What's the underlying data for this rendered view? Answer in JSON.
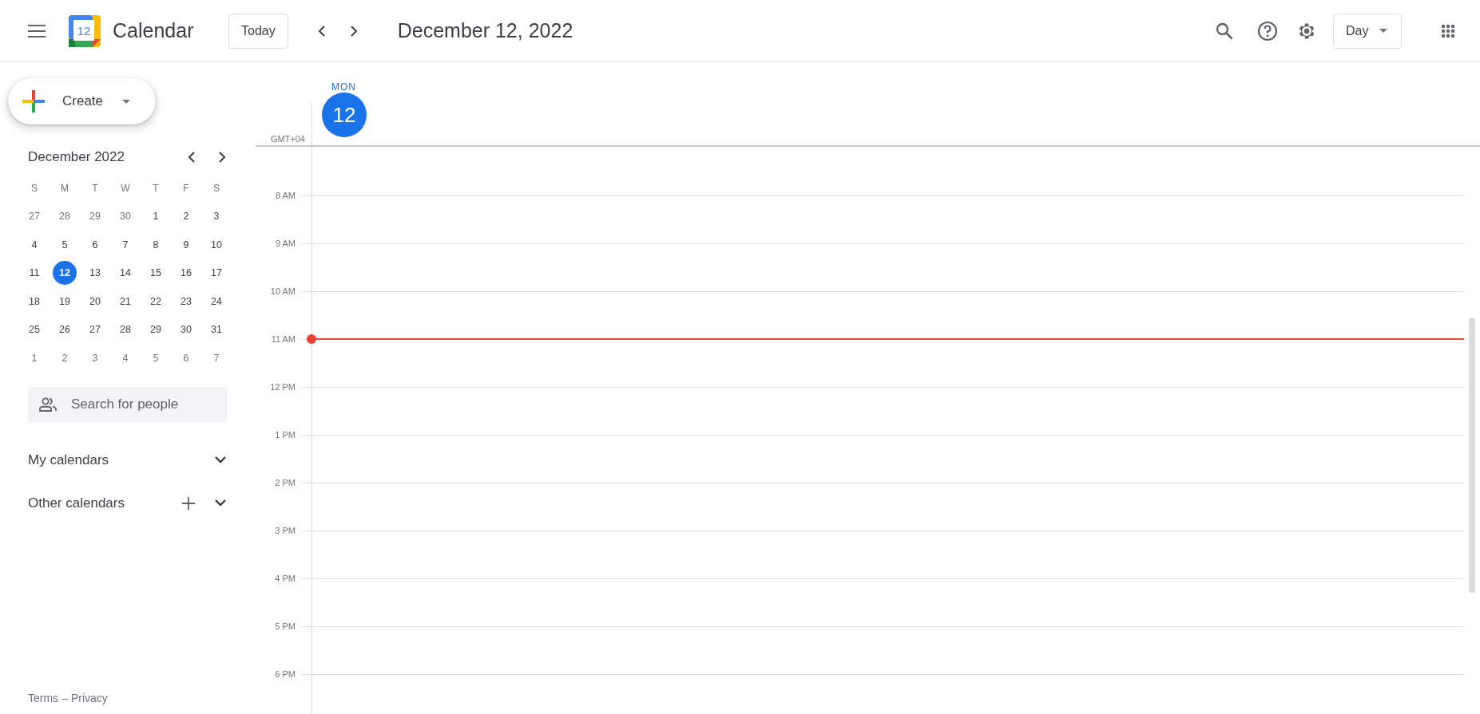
{
  "header": {
    "app_name": "Calendar",
    "logo_day": "12",
    "today_button": "Today",
    "date_title": "December 12, 2022",
    "view_select": "Day"
  },
  "sidebar": {
    "create_button": "Create",
    "mini_calendar": {
      "title": "December 2022",
      "weekdays": [
        "S",
        "M",
        "T",
        "W",
        "T",
        "F",
        "S"
      ],
      "weeks": [
        [
          {
            "day": "27",
            "muted": true,
            "selected": false
          },
          {
            "day": "28",
            "muted": true,
            "selected": false
          },
          {
            "day": "29",
            "muted": true,
            "selected": false
          },
          {
            "day": "30",
            "muted": true,
            "selected": false
          },
          {
            "day": "1",
            "muted": false,
            "selected": false
          },
          {
            "day": "2",
            "muted": false,
            "selected": false
          },
          {
            "day": "3",
            "muted": false,
            "selected": false
          }
        ],
        [
          {
            "day": "4",
            "muted": false,
            "selected": false
          },
          {
            "day": "5",
            "muted": false,
            "selected": false
          },
          {
            "day": "6",
            "muted": false,
            "selected": false
          },
          {
            "day": "7",
            "muted": false,
            "selected": false
          },
          {
            "day": "8",
            "muted": false,
            "selected": false
          },
          {
            "day": "9",
            "muted": false,
            "selected": false
          },
          {
            "day": "10",
            "muted": false,
            "selected": false
          }
        ],
        [
          {
            "day": "11",
            "muted": false,
            "selected": false
          },
          {
            "day": "12",
            "muted": false,
            "selected": true
          },
          {
            "day": "13",
            "muted": false,
            "selected": false
          },
          {
            "day": "14",
            "muted": false,
            "selected": false
          },
          {
            "day": "15",
            "muted": false,
            "selected": false
          },
          {
            "day": "16",
            "muted": false,
            "selected": false
          },
          {
            "day": "17",
            "muted": false,
            "selected": false
          }
        ],
        [
          {
            "day": "18",
            "muted": false,
            "selected": false
          },
          {
            "day": "19",
            "muted": false,
            "selected": false
          },
          {
            "day": "20",
            "muted": false,
            "selected": false
          },
          {
            "day": "21",
            "muted": false,
            "selected": false
          },
          {
            "day": "22",
            "muted": false,
            "selected": false
          },
          {
            "day": "23",
            "muted": false,
            "selected": false
          },
          {
            "day": "24",
            "muted": false,
            "selected": false
          }
        ],
        [
          {
            "day": "25",
            "muted": false,
            "selected": false
          },
          {
            "day": "26",
            "muted": false,
            "selected": false
          },
          {
            "day": "27",
            "muted": false,
            "selected": false
          },
          {
            "day": "28",
            "muted": false,
            "selected": false
          },
          {
            "day": "29",
            "muted": false,
            "selected": false
          },
          {
            "day": "30",
            "muted": false,
            "selected": false
          },
          {
            "day": "31",
            "muted": false,
            "selected": false
          }
        ],
        [
          {
            "day": "1",
            "muted": true,
            "selected": false
          },
          {
            "day": "2",
            "muted": true,
            "selected": false
          },
          {
            "day": "3",
            "muted": true,
            "selected": false
          },
          {
            "day": "4",
            "muted": true,
            "selected": false
          },
          {
            "day": "5",
            "muted": true,
            "selected": false
          },
          {
            "day": "6",
            "muted": true,
            "selected": false
          },
          {
            "day": "7",
            "muted": true,
            "selected": false
          }
        ]
      ]
    },
    "search_people": {
      "placeholder": "Search for people"
    },
    "sections": [
      {
        "label": "My calendars",
        "expanded": false,
        "addable": false
      },
      {
        "label": "Other calendars",
        "expanded": false,
        "addable": true
      }
    ],
    "footer": {
      "terms": "Terms",
      "separator": "–",
      "privacy": "Privacy"
    }
  },
  "day_view": {
    "weekday": "MON",
    "date": "12",
    "timezone": "GMT+04",
    "hours": [
      {
        "label": "8 AM",
        "current": false
      },
      {
        "label": "9 AM",
        "current": false
      },
      {
        "label": "10 AM",
        "current": false
      },
      {
        "label": "11 AM",
        "current": true
      },
      {
        "label": "12 PM",
        "current": false
      },
      {
        "label": "1 PM",
        "current": false
      },
      {
        "label": "2 PM",
        "current": false
      },
      {
        "label": "3 PM",
        "current": false
      },
      {
        "label": "4 PM",
        "current": false
      },
      {
        "label": "5 PM",
        "current": false
      },
      {
        "label": "6 PM",
        "current": false
      }
    ]
  }
}
